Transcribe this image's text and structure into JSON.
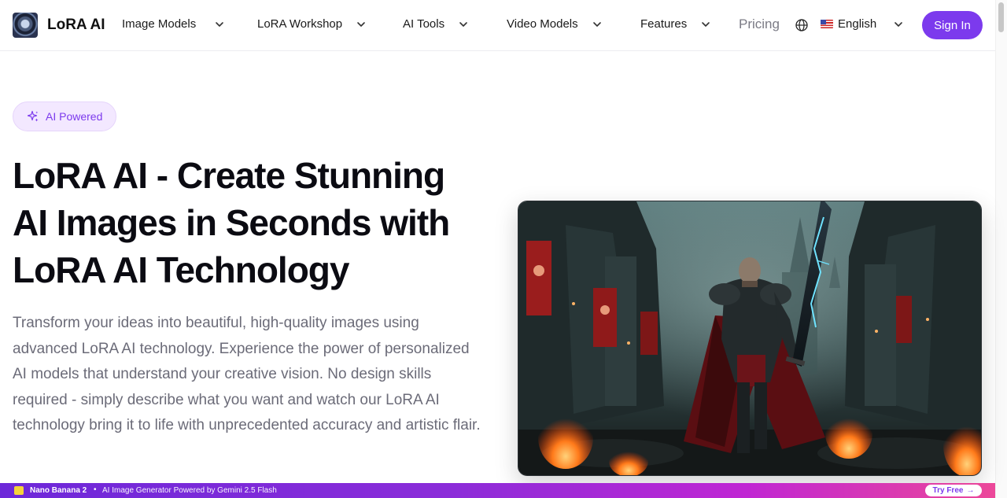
{
  "header": {
    "brand": "LoRA AI",
    "nav": [
      "Image Models",
      "LoRA Workshop",
      "AI Tools",
      "Video Models",
      "Features"
    ],
    "pricing": "Pricing",
    "language": "English",
    "sign_in": "Sign In"
  },
  "hero": {
    "badge": "AI Powered",
    "title": "LoRA AI - Create Stunning AI Images in Seconds with LoRA AI Technology",
    "description": "Transform your ideas into beautiful, high-quality images using advanced LoRA AI technology. Experience the power of personalized AI models that understand your creative vision. No design skills required - simply describe what you want and watch our LoRA AI technology bring it to life with unprecedented accuracy and artistic flair."
  },
  "banner": {
    "brand": "Nano Banana 2",
    "separator": "•",
    "text": "AI Image Generator Powered by Gemini 2.5 Flash",
    "cta": "Try Free",
    "cta_arrow": "→"
  },
  "colors": {
    "accent": "#7c3aed",
    "badge_bg": "#f3e8ff",
    "text_muted": "#6b6b78"
  },
  "icons": {
    "logo": "lora-ai-logo",
    "nav_chevron": "chevron-down-icon",
    "language": "globe-icon",
    "badge": "sparkles-icon"
  }
}
